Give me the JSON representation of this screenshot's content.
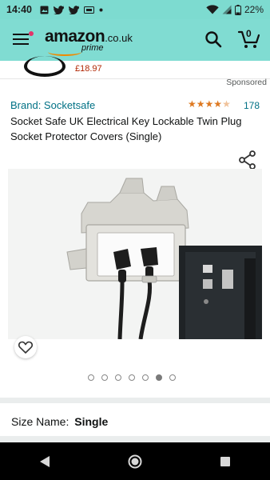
{
  "status": {
    "time": "14:40",
    "battery": "22%",
    "left_icons": [
      "image-icon",
      "twitter-icon",
      "twitter-icon",
      "sim-icon",
      "dot-icon"
    ],
    "right_icons": [
      "wifi-icon",
      "signal-icon",
      "battery-icon"
    ]
  },
  "header": {
    "logo_word": "amazon",
    "logo_tld": ".co.uk",
    "logo_sub": "prime",
    "cart_count": "0",
    "colors": {
      "header_bg": "#80dcd2",
      "menu_dot": "#e3346a"
    }
  },
  "previous_item": {
    "price": "£18.97"
  },
  "sponsored_label": "Sponsored",
  "product": {
    "brand": "Brand: Socketsafe",
    "rating": 4.5,
    "rating_count": "178",
    "title": "Socket Safe UK Electrical Key Lockable Twin Plug Socket Protector Covers (Single)",
    "image_count": 7,
    "active_image": 6
  },
  "size": {
    "label": "Size Name:",
    "value": "Single"
  },
  "nav": {
    "buttons": [
      "back-button",
      "home-button",
      "recents-button"
    ]
  }
}
